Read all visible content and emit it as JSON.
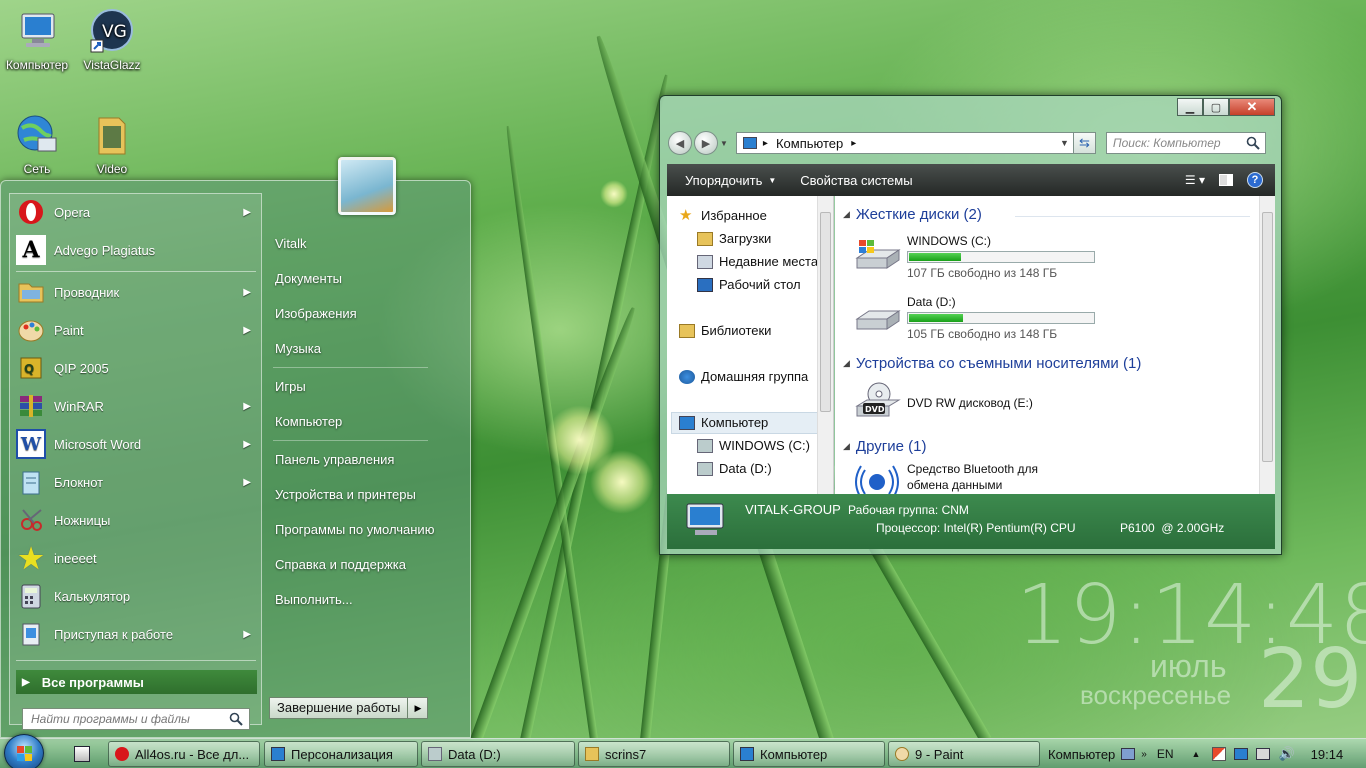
{
  "desktop": {
    "icons": [
      {
        "label": "Компьютер"
      },
      {
        "label": "VistaGlazz"
      },
      {
        "label": "Сеть"
      },
      {
        "label": "Video"
      }
    ]
  },
  "start_menu": {
    "programs": [
      {
        "label": "Opera",
        "icon": "opera-icon"
      },
      {
        "label": "Advego Plagiatus",
        "icon": "advego-icon"
      },
      {
        "label": "Проводник",
        "icon": "explorer-icon"
      },
      {
        "label": "Paint",
        "icon": "paint-icon"
      },
      {
        "label": "QIP 2005",
        "icon": "qip-icon"
      },
      {
        "label": "WinRAR",
        "icon": "winrar-icon"
      },
      {
        "label": "Microsoft Word",
        "icon": "word-icon"
      },
      {
        "label": "Блокнот",
        "icon": "notepad-icon"
      },
      {
        "label": "Ножницы",
        "icon": "scissors-icon"
      },
      {
        "label": "ineeeet",
        "icon": "star-icon"
      },
      {
        "label": "Калькулятор",
        "icon": "calculator-icon"
      },
      {
        "label": "Приступая к работе",
        "icon": "getting-started-icon"
      }
    ],
    "all_programs": "Все программы",
    "search_placeholder": "Найти программы и файлы",
    "right_items": [
      "Vitalk",
      "Документы",
      "Изображения",
      "Музыка",
      "Игры",
      "Компьютер",
      "Панель управления",
      "Устройства и принтеры",
      "Программы по умолчанию",
      "Справка и поддержка",
      "Выполнить..."
    ],
    "shutdown": "Завершение работы"
  },
  "explorer": {
    "address": "Компьютер",
    "search_placeholder": "Поиск: Компьютер",
    "toolbar": {
      "organize": "Упорядочить",
      "system_properties": "Свойства системы"
    },
    "nav": {
      "favorites": "Избранное",
      "downloads": "Загрузки",
      "recent": "Недавние места",
      "desktop": "Рабочий стол",
      "libraries": "Библиотеки",
      "homegroup": "Домашняя группа",
      "computer": "Компьютер",
      "drive_c": "WINDOWS (C:)",
      "drive_d": "Data (D:)"
    },
    "groups": {
      "hard_disks": "Жесткие диски (2)",
      "removable": "Устройства со съемными носителями (1)",
      "other": "Другие (1)"
    },
    "drives": [
      {
        "name": "WINDOWS (C:)",
        "free": "107 ГБ свободно из 148 ГБ",
        "used_fraction": 0.28
      },
      {
        "name": "Data (D:)",
        "free": "105 ГБ свободно из 148 ГБ",
        "used_fraction": 0.29
      }
    ],
    "dvd": "DVD RW дисковод (E:)",
    "dvd_badge": "DVD",
    "bluetooth_line1": "Средство Bluetooth для",
    "bluetooth_line2": "обмена данными",
    "details": {
      "name": "VITALK-GROUP",
      "workgroup": "Рабочая группа: CNM",
      "cpu": "Процессор: Intel(R) Pentium(R) CPU",
      "cpu_model": "P6100  @ 2.00GHz"
    }
  },
  "clock": {
    "time": "19:14:48",
    "month": "июль",
    "day": "29",
    "weekday": "воскресенье"
  },
  "taskbar": {
    "buttons": [
      {
        "label": "All4os.ru - Все дл..."
      },
      {
        "label": "Персонализация"
      },
      {
        "label": "Data (D:)"
      },
      {
        "label": "scrins7"
      },
      {
        "label": "Компьютер"
      },
      {
        "label": "9 - Paint"
      }
    ],
    "tray_label": "Компьютер",
    "lang": "EN",
    "time": "19:14"
  },
  "colors": {
    "accent": "#2f6f2d",
    "link_blue": "#1e3f9a",
    "drive_fill": "#18a018"
  }
}
